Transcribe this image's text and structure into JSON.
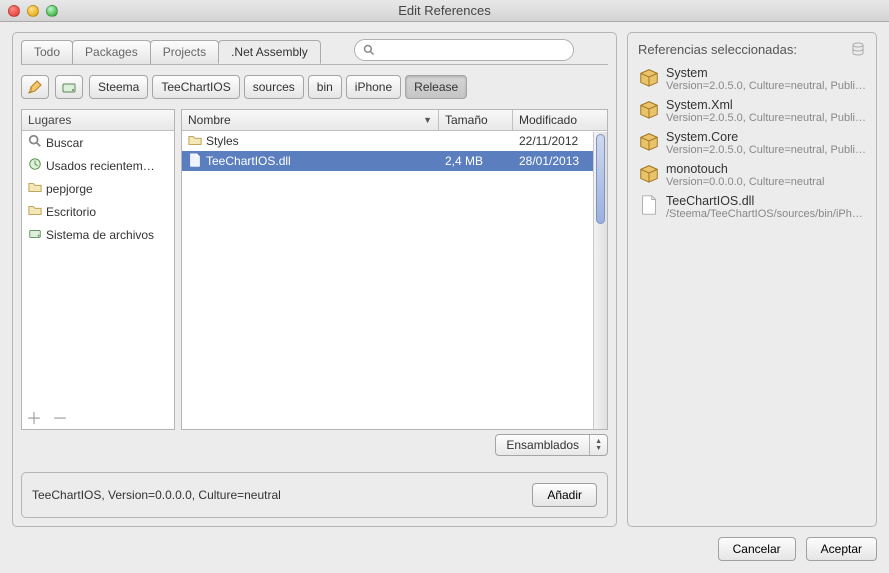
{
  "window": {
    "title": "Edit References"
  },
  "tabs": [
    {
      "label": "Todo"
    },
    {
      "label": "Packages"
    },
    {
      "label": "Projects"
    },
    {
      "label": ".Net Assembly",
      "active": true
    }
  ],
  "search": {
    "placeholder": ""
  },
  "breadcrumb": [
    "Steema",
    "TeeChartIOS",
    "sources",
    "bin",
    "iPhone",
    "Release"
  ],
  "places": {
    "header": "Lugares",
    "items": [
      {
        "icon": "search",
        "label": "Buscar"
      },
      {
        "icon": "recent",
        "label": "Usados recientem…"
      },
      {
        "icon": "folder",
        "label": "pepjorge"
      },
      {
        "icon": "folder",
        "label": "Escritorio"
      },
      {
        "icon": "drive",
        "label": "Sistema de archivos"
      }
    ]
  },
  "file_cols": {
    "name": "Nombre",
    "size": "Tamaño",
    "modified": "Modificado"
  },
  "files": [
    {
      "icon": "folder",
      "name": "Styles",
      "size": "",
      "modified": "22/11/2012",
      "selected": false
    },
    {
      "icon": "dll",
      "name": "TeeChartIOS.dll",
      "size": "2,4 MB",
      "modified": "28/01/2013",
      "selected": true
    }
  ],
  "dropdown": {
    "label": "Ensamblados"
  },
  "status": {
    "text": "TeeChartIOS, Version=0.0.0.0, Culture=neutral"
  },
  "buttons": {
    "add": "Añadir",
    "cancel": "Cancelar",
    "accept": "Aceptar"
  },
  "right": {
    "header": "Referencias seleccionadas:",
    "items": [
      {
        "icon": "pkg",
        "name": "System",
        "sub": "Version=2.0.5.0, Culture=neutral, Public…"
      },
      {
        "icon": "pkg",
        "name": "System.Xml",
        "sub": "Version=2.0.5.0, Culture=neutral, Public…"
      },
      {
        "icon": "pkg",
        "name": "System.Core",
        "sub": "Version=2.0.5.0, Culture=neutral, Public…"
      },
      {
        "icon": "pkg",
        "name": "monotouch",
        "sub": "Version=0.0.0.0, Culture=neutral"
      },
      {
        "icon": "file",
        "name": "TeeChartIOS.dll",
        "sub": "/Steema/TeeChartIOS/sources/bin/iPhon…"
      }
    ]
  }
}
